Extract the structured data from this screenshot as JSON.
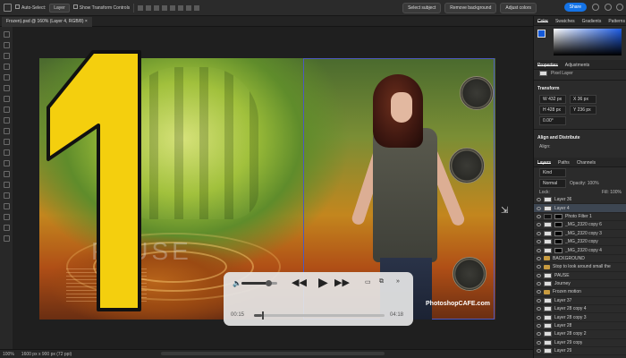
{
  "options_bar": {
    "auto_select_label": "Auto-Select:",
    "auto_select_target": "Layer",
    "show_transform_label": "Show Transform Controls",
    "select_subject": "Select subject",
    "remove_background": "Remove background",
    "adjust_colors": "Adjust colors",
    "share": "Share"
  },
  "document": {
    "tab_title": "Frozen).psd @ 160% (Layer 4, RGB/8)",
    "canvas_text": "PAUSE",
    "watermark": "PhotoshopCAFE.com"
  },
  "thumbnail_overlay": {
    "big_number": "1"
  },
  "player": {
    "current_time": "00:15",
    "total_time": "04:18",
    "progress": 0.06,
    "volume": 0.75
  },
  "status_bar": {
    "zoom": "100%",
    "size": "1600 px x 900 px (72 ppi)"
  },
  "right_panel": {
    "color_tabs": [
      "Color",
      "Swatches",
      "Gradients",
      "Patterns"
    ],
    "color_fg": "#1459d8",
    "props_tabs": [
      "Properties",
      "Adjustments"
    ],
    "pixel_layer": "Pixel Layer",
    "transform_title": "Transform",
    "w": "W 432 px",
    "h": "H 428 px",
    "x": "X 36 px",
    "y": "Y 236 px",
    "angle": "0.00°",
    "align_title": "Align and Distribute",
    "align_label": "Align:",
    "layers_tabs": [
      "Layers",
      "Paths",
      "Channels"
    ],
    "kind": "Kind",
    "blend": "Normal",
    "opacity": "Opacity: 100%",
    "lock": "Lock:",
    "fill": "Fill: 100%",
    "layers": [
      {
        "name": "Layer 36",
        "type": "pixel",
        "selected": false
      },
      {
        "name": "Layer 4",
        "type": "pixel",
        "selected": true
      },
      {
        "name": "Photo Filter 1",
        "type": "adjust",
        "selected": false
      },
      {
        "name": "_MG_2320 copy 6",
        "type": "mask",
        "selected": false
      },
      {
        "name": "_MG_2320 copy 3",
        "type": "mask",
        "selected": false
      },
      {
        "name": "_MG_2320 copy",
        "type": "mask",
        "selected": false
      },
      {
        "name": "_MG_2320 copy 4",
        "type": "mask",
        "selected": false
      },
      {
        "name": "BACKGROUND",
        "type": "folder",
        "selected": false
      },
      {
        "name": "Stop to look around small the",
        "type": "folder",
        "selected": false
      },
      {
        "name": "PAUSE",
        "type": "pixel",
        "selected": false
      },
      {
        "name": "Journey",
        "type": "pixel",
        "selected": false
      },
      {
        "name": "Frozen  motion",
        "type": "folder",
        "selected": false
      },
      {
        "name": "Layer 37",
        "type": "pixel",
        "selected": false
      },
      {
        "name": "Layer 28 copy 4",
        "type": "pixel",
        "selected": false
      },
      {
        "name": "Layer 28 copy 3",
        "type": "pixel",
        "selected": false
      },
      {
        "name": "Layer 28",
        "type": "pixel",
        "selected": false
      },
      {
        "name": "Layer 28 copy 2",
        "type": "pixel",
        "selected": false
      },
      {
        "name": "Layer 29 copy",
        "type": "pixel",
        "selected": false
      },
      {
        "name": "Layer 29",
        "type": "pixel",
        "selected": false
      }
    ]
  }
}
